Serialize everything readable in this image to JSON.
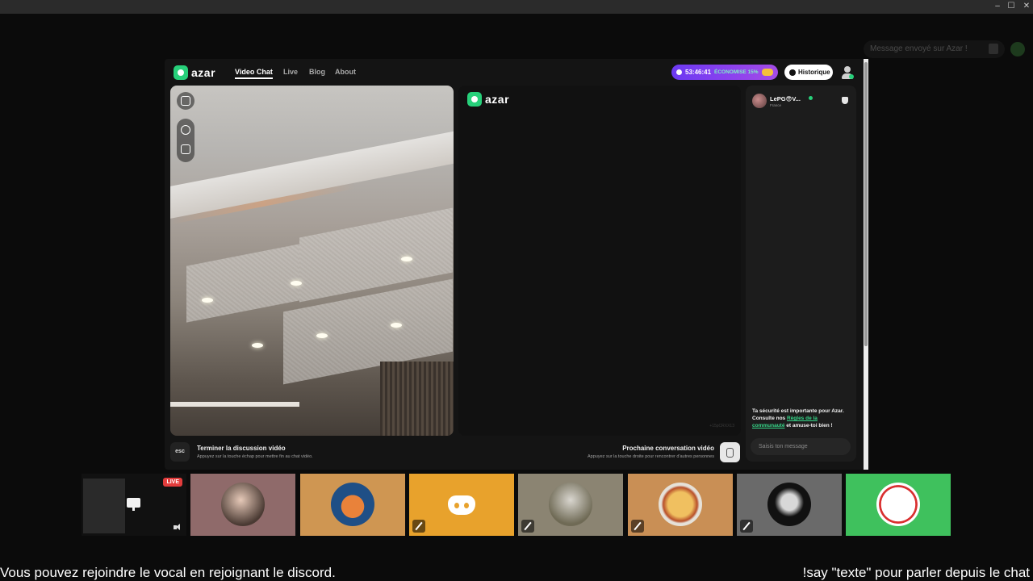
{
  "window": {
    "minimize": "–",
    "maximize": "☐",
    "close": "✕"
  },
  "overlay": {
    "message_placeholder": "Message envoyé sur Azar !"
  },
  "azar": {
    "logo": "azar",
    "nav": [
      "Video Chat",
      "Live",
      "Blog",
      "About"
    ],
    "timer": {
      "time": "53:46:41",
      "promo": "ÉCONOMISE 15%"
    },
    "history_label": "Historique",
    "peer": {
      "name": "LePG😎V...",
      "country": "France"
    },
    "safety": {
      "before": "Ta sécurité est importante pour Azar. Consulte nos ",
      "link": "Règles de la communauté",
      "after": " et amuse-toi bien !"
    },
    "chat_placeholder": "Saisis ton message",
    "watermark": "+15pCRXX13",
    "end": {
      "key": "esc",
      "title": "Terminer la discussion vidéo",
      "sub": "Appuyez sur la touche échap pour mettre fin au chat vidéo."
    },
    "next": {
      "title": "Prochaine conversation vidéo",
      "sub": "Appuyez sur la touche droite pour rencontrer d'autres personnes"
    }
  },
  "participants": [
    {
      "name": "streamer-screen",
      "live": "LIVE",
      "bg": "#111111"
    },
    {
      "name": "participant-2",
      "bg": "#8f6a6a"
    },
    {
      "name": "participant-3",
      "bg": "#cf9652"
    },
    {
      "name": "participant-4-discord",
      "bg": "#e8a22c"
    },
    {
      "name": "participant-5",
      "bg": "#8b8472"
    },
    {
      "name": "participant-6",
      "bg": "#c98f55"
    },
    {
      "name": "participant-7",
      "bg": "#6a6a6a"
    },
    {
      "name": "participant-8",
      "bg": "#3fc15d"
    }
  ],
  "captions": {
    "left": "Vous pouvez rejoindre le vocal en rejoignant le discord.",
    "right": "!say \"texte\" pour parler depuis le chat"
  },
  "colors": {
    "accent_green": "#27d07a",
    "timer_purple": "#7a3ff0",
    "live_red": "#e23c3c"
  }
}
